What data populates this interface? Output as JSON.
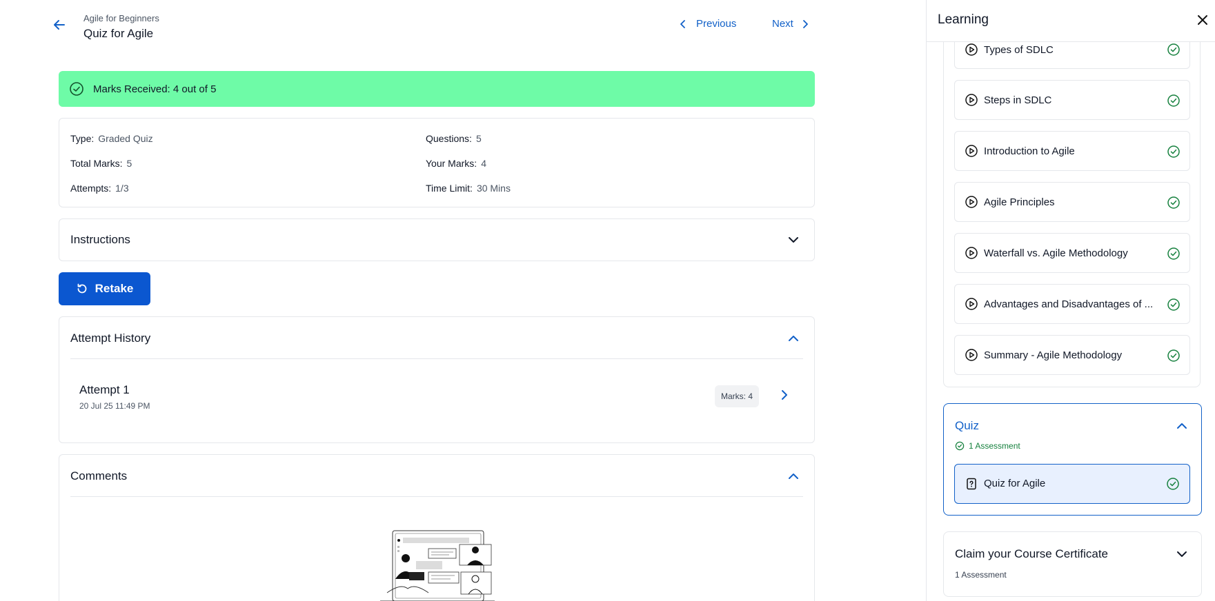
{
  "header": {
    "breadcrumb": "Agile for Beginners",
    "title": "Quiz for Agile",
    "prev_label": "Previous",
    "next_label": "Next"
  },
  "banner": {
    "text": "Marks Received: 4 out of 5",
    "color": "#6efba7"
  },
  "info": {
    "type_label": "Type:",
    "type_value": "Graded Quiz",
    "questions_label": "Questions:",
    "questions_value": "5",
    "total_label": "Total Marks:",
    "total_value": "5",
    "your_label": "Your Marks:",
    "your_value": "4",
    "attempts_label": "Attempts:",
    "attempts_value": "1/3",
    "time_label": "Time Limit:",
    "time_value": "30 Mins"
  },
  "instructions": {
    "title": "Instructions"
  },
  "retake": {
    "label": "Retake"
  },
  "history": {
    "title": "Attempt History",
    "attempts": [
      {
        "title": "Attempt 1",
        "date": "20 Jul 25 11:49 PM",
        "marks": "Marks: 4"
      }
    ]
  },
  "comments": {
    "title": "Comments"
  },
  "sidebar": {
    "title": "Learning",
    "lessons": [
      {
        "label": "Types of SDLC"
      },
      {
        "label": "Steps in SDLC"
      },
      {
        "label": "Introduction to Agile"
      },
      {
        "label": "Agile Principles"
      },
      {
        "label": "Waterfall vs. Agile Methodology"
      },
      {
        "label": "Advantages and Disadvantages of ..."
      },
      {
        "label": "Summary - Agile Methodology"
      }
    ],
    "quiz_section": {
      "title": "Quiz",
      "subtitle": "1 Assessment",
      "item": "Quiz for Agile"
    },
    "certificate_section": {
      "title": "Claim your Course Certificate",
      "subtitle": "1 Assessment"
    }
  },
  "colors": {
    "accent": "#1160c8",
    "primary_button": "#0b57d0",
    "success": "#15803d",
    "active_item_bg": "#e8f0fe"
  }
}
